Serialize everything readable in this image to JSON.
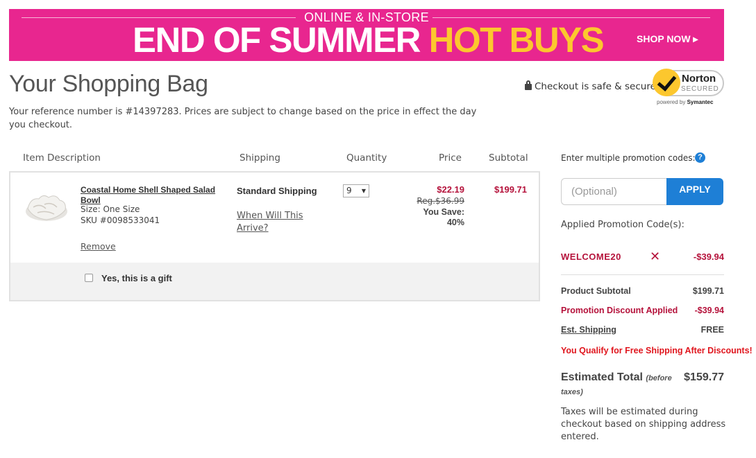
{
  "banner": {
    "subtitle": "ONLINE & IN-STORE",
    "headline_white": "END OF SUMMER ",
    "headline_yellow": "HOT BUYS",
    "cta": "SHOP NOW ▸",
    "colors": {
      "background": "#e8268f",
      "accent": "#fcc72e"
    }
  },
  "page": {
    "title": "Your Shopping Bag",
    "reference_text": "Your reference number is #14397283.   Prices are subject to change based on the price in effect the day you checkout.",
    "secure_text": "Checkout is safe & secure",
    "norton": {
      "brand": "Norton",
      "secured": "SECURED",
      "powered_prefix": "powered by ",
      "powered_brand": "Symantec"
    }
  },
  "table": {
    "headers": [
      "Item Description",
      "Shipping",
      "Quantity",
      "Price",
      "Subtotal"
    ]
  },
  "item": {
    "name": "Coastal Home Shell Shaped Salad Bowl",
    "size": "Size: One Size",
    "sku": "SKU #0098533041",
    "remove": "Remove",
    "shipping_method": "Standard Shipping",
    "shipping_link": "When Will This Arrive?",
    "quantity": "9",
    "price": "$22.19",
    "reg_price": "Reg.$36.99",
    "you_save_label": "You Save:",
    "you_save_pct": "40%",
    "subtotal": "$199.71",
    "gift_label": "Yes, this is a gift"
  },
  "promo": {
    "label": "Enter multiple promotion codes:",
    "help": "?",
    "placeholder": "(Optional)",
    "apply": "APPLY",
    "applied_label": "Applied Promotion Code(s):",
    "code": "WELCOME20",
    "remove_icon": "✕",
    "code_amount": "-$39.94"
  },
  "summary": {
    "product_subtotal_label": "Product Subtotal",
    "product_subtotal": "$199.71",
    "discount_label": "Promotion Discount Applied",
    "discount": "-$39.94",
    "shipping_label": "Est. Shipping",
    "shipping": "FREE",
    "qualify_text": "You Qualify for Free Shipping After Discounts!",
    "estimated_total_label": "Estimated Total",
    "estimated_total_note_1": "(before",
    "estimated_total_note_2": "taxes)",
    "estimated_total": "$159.77",
    "taxes_note": "Taxes will be estimated during checkout based on shipping address entered."
  }
}
